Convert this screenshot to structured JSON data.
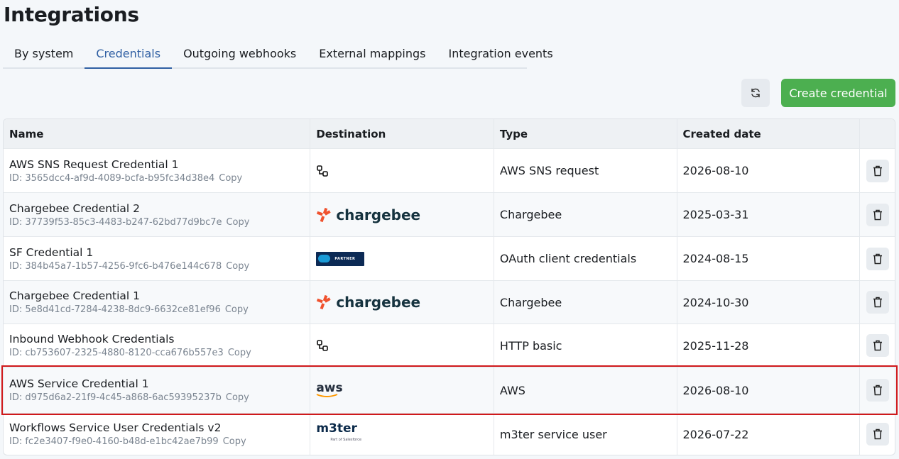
{
  "page": {
    "title": "Integrations"
  },
  "tabs": [
    {
      "label": "By system"
    },
    {
      "label": "Credentials"
    },
    {
      "label": "Outgoing webhooks"
    },
    {
      "label": "External mappings"
    },
    {
      "label": "Integration events"
    }
  ],
  "toolbar": {
    "create_label": "Create credential",
    "refresh_icon": "refresh-icon"
  },
  "table": {
    "headers": {
      "name": "Name",
      "destination": "Destination",
      "type": "Type",
      "created": "Created date"
    },
    "copy_label": "Copy",
    "rows": [
      {
        "name": "AWS SNS Request Credential 1",
        "id": "ID: 3565dcc4-af9d-4089-bcfa-b95fc34d38e4",
        "destination": "generic-connector-icon",
        "type": "AWS SNS request",
        "created": "2026-08-10"
      },
      {
        "name": "Chargebee Credential 2",
        "id": "ID: 37739f53-85c3-4483-b247-62bd77d9bc7e",
        "destination": "chargebee",
        "destination_text": "chargebee",
        "type": "Chargebee",
        "created": "2025-03-31"
      },
      {
        "name": "SF Credential 1",
        "id": "ID: 384b45a7-1b57-4256-9fc6-b476e144c678",
        "destination": "salesforce-partner",
        "destination_text": "PARTNER",
        "type": "OAuth client credentials",
        "created": "2024-08-15"
      },
      {
        "name": "Chargebee Credential 1",
        "id": "ID: 5e8d41cd-7284-4238-8dc9-6632ce81ef96",
        "destination": "chargebee",
        "destination_text": "chargebee",
        "type": "Chargebee",
        "created": "2024-10-30"
      },
      {
        "name": "Inbound Webhook Credentials",
        "id": "ID: cb753607-2325-4880-8120-cca676b557e3",
        "destination": "generic-connector-icon",
        "type": "HTTP basic",
        "created": "2025-11-28"
      },
      {
        "name": "AWS Service Credential 1",
        "id": "ID: d975d6a2-21f9-4c45-a868-6ac59395237b",
        "destination": "aws",
        "destination_text": "aws",
        "type": "AWS",
        "created": "2026-08-10",
        "highlighted": true
      },
      {
        "name": "Workflows Service User Credentials v2",
        "id": "ID: fc2e3407-f9e0-4160-b48d-e1bc42ae7b99",
        "destination": "m3ter",
        "destination_text": "m3ter",
        "destination_subtext": "Part of Salesforce",
        "type": "m3ter service user",
        "created": "2026-07-22"
      }
    ]
  },
  "colors": {
    "accent": "#2f5fa3",
    "create_button": "#4caf50",
    "highlight_border": "#d0191b"
  }
}
